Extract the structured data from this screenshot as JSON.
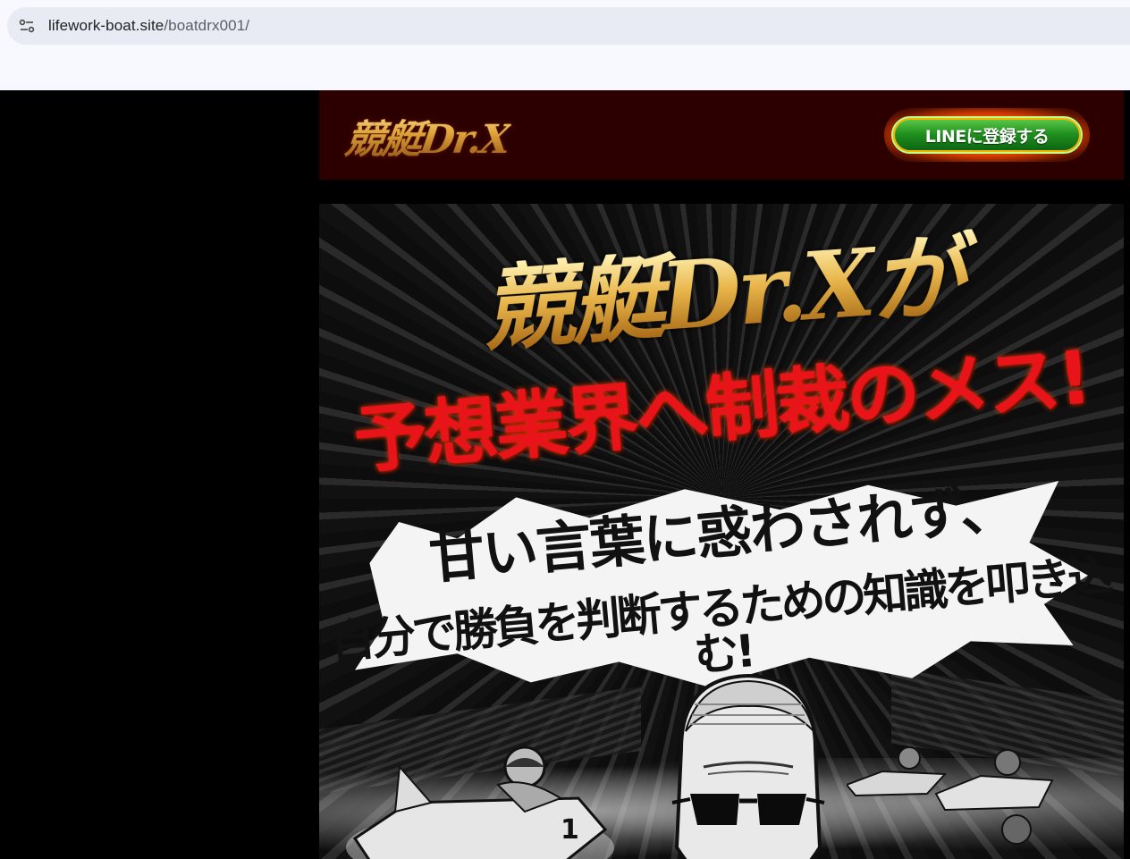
{
  "browser": {
    "url_host": "lifework-boat.site",
    "url_path": "/boatdrx001/",
    "site_info_icon": "tune-icon"
  },
  "header": {
    "logo_text": "競艇Dr.X",
    "line_button_label": "LINEに登録する"
  },
  "hero": {
    "headline_1": "競艇Dr.Xが",
    "headline_2": "予想業界へ制裁のメス!",
    "sub_1": "甘い言葉に惑わされず、",
    "sub_2": "自分で勝負を判断するための知識を叩き込む!",
    "boat_number": "1"
  },
  "colors": {
    "header_bg": "#2d0000",
    "accent_gold": "#e1a43a",
    "accent_red": "#e8141a",
    "line_green": "#1f8f1d"
  }
}
